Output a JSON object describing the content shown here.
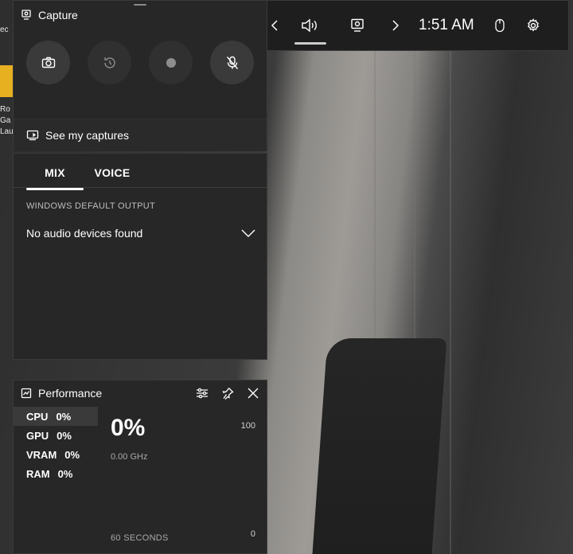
{
  "topbar": {
    "time": "1:51 AM",
    "buttons": [
      "widget-menu",
      "previous",
      "audio",
      "capture",
      "next",
      "mouse",
      "settings"
    ]
  },
  "capture_panel": {
    "title": "Capture",
    "see_captures_label": "See my captures",
    "icons": [
      "camera-icon",
      "record-last-icon",
      "record-icon",
      "mic-muted-icon"
    ]
  },
  "audio_panel": {
    "tabs": [
      {
        "label": "MIX",
        "active": true
      },
      {
        "label": "VOICE",
        "active": false
      }
    ],
    "section_label": "WINDOWS DEFAULT OUTPUT",
    "device": "No audio devices found"
  },
  "performance_panel": {
    "title": "Performance",
    "metrics": [
      {
        "name": "CPU",
        "value": "0%",
        "selected": true
      },
      {
        "name": "GPU",
        "value": "0%"
      },
      {
        "name": "VRAM",
        "value": "0%"
      },
      {
        "name": "RAM",
        "value": "0%"
      }
    ],
    "big_value": "0%",
    "frequency": "0.00 GHz",
    "max_label": "100",
    "min_label": "0",
    "duration_label": "60 SECONDS"
  },
  "desktop": {
    "icon_fragments": [
      "ec",
      "Ro",
      "Ga",
      "Lau"
    ]
  }
}
